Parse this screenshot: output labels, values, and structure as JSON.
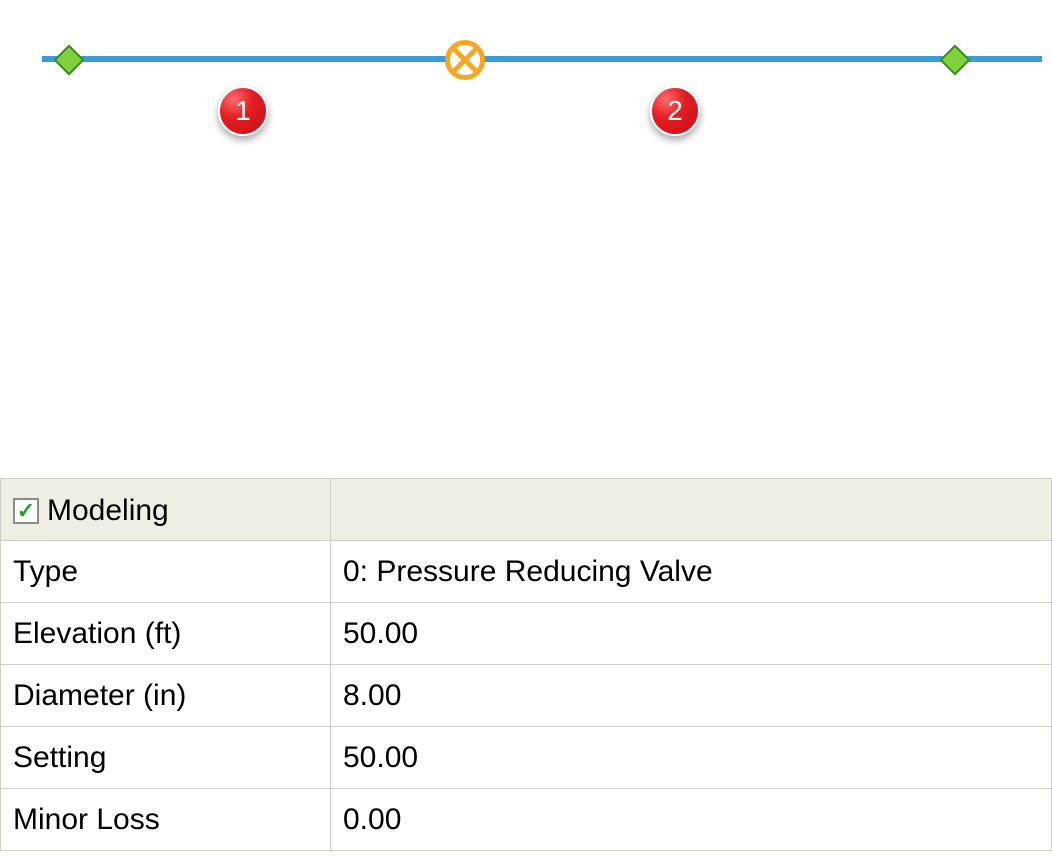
{
  "diagram": {
    "badge1": "1",
    "badge2": "2"
  },
  "properties": {
    "section_title": "Modeling",
    "rows": [
      {
        "label": "Type",
        "value": "0: Pressure Reducing Valve"
      },
      {
        "label": "Elevation (ft)",
        "value": "50.00"
      },
      {
        "label": "Diameter (in)",
        "value": "8.00"
      },
      {
        "label": "Setting",
        "value": "50.00"
      },
      {
        "label": "Minor Loss",
        "value": "0.00"
      }
    ]
  }
}
